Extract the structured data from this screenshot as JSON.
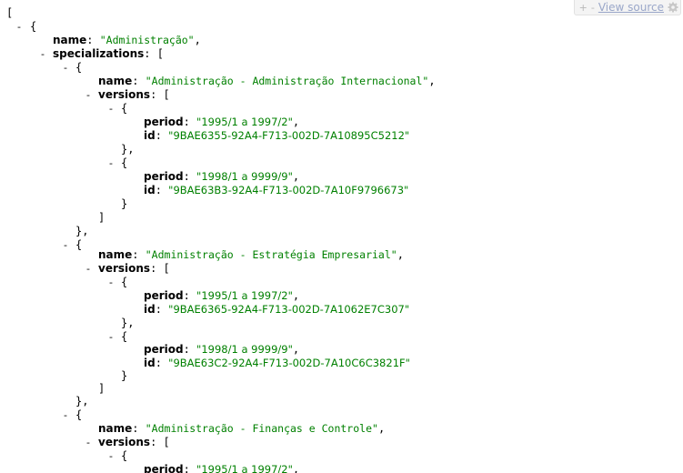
{
  "toolbar": {
    "expand_label": "+",
    "collapse_label": "-",
    "view_source_label": "View source"
  },
  "glyphs": {
    "collapse": "-",
    "open_array": "[",
    "close_array": "]",
    "open_object": "{",
    "close_object": "}",
    "close_object_comma": "},",
    "colon": ": ",
    "comma": ","
  },
  "keys": {
    "name": "name",
    "specializations": "specializations",
    "versions": "versions",
    "period": "period",
    "id": "id"
  },
  "json": {
    "root_name": "\"Administração\"",
    "specializations": [
      {
        "name": "\"Administração - Administração Internacional\"",
        "versions": [
          {
            "period": "\"1995/1 a 1997/2\"",
            "id": "\"9BAE6355-92A4-F713-002D-7A10895C5212\""
          },
          {
            "period": "\"1998/1 a 9999/9\"",
            "id": "\"9BAE63B3-92A4-F713-002D-7A10F9796673\""
          }
        ]
      },
      {
        "name": "\"Administração - Estratégia Empresarial\"",
        "versions": [
          {
            "period": "\"1995/1 a 1997/2\"",
            "id": "\"9BAE6365-92A4-F713-002D-7A1062E7C307\""
          },
          {
            "period": "\"1998/1 a 9999/9\"",
            "id": "\"9BAE63C2-92A4-F713-002D-7A10C6C3821F\""
          }
        ]
      },
      {
        "name": "\"Administração - Finanças e Controle\"",
        "versions": [
          {
            "period": "\"1995/1 a 1997/2\""
          }
        ]
      }
    ]
  },
  "colors": {
    "string": "#008000",
    "key": "#000000",
    "link": "#9aa7c9",
    "toolbar_bg": "#f4f4f4"
  }
}
